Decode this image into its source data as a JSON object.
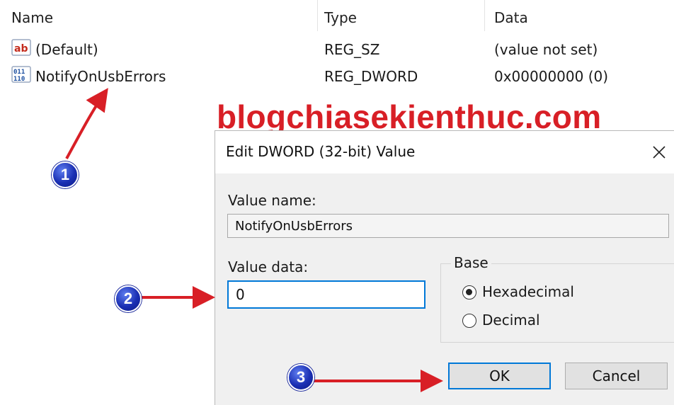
{
  "columns": {
    "name": "Name",
    "type": "Type",
    "data": "Data"
  },
  "rows": [
    {
      "icon": "string-value-icon",
      "icon_text": "ab",
      "name": "(Default)",
      "type": "REG_SZ",
      "data": "(value not set)"
    },
    {
      "icon": "dword-value-icon",
      "icon_text": "011 110",
      "name": "NotifyOnUsbErrors",
      "type": "REG_DWORD",
      "data": "0x00000000 (0)"
    }
  ],
  "watermark": "blogchiasekienthuc.com",
  "dialog": {
    "title": "Edit DWORD (32-bit) Value",
    "close_glyph": "✕",
    "value_name_label": "Value name:",
    "value_name": "NotifyOnUsbErrors",
    "value_data_label": "Value data:",
    "value_data": "0",
    "base_label": "Base",
    "radio_hex": "Hexadecimal",
    "radio_dec": "Decimal",
    "selected_base": "Hexadecimal",
    "ok_label": "OK",
    "cancel_label": "Cancel"
  },
  "badges": [
    "1",
    "2",
    "3"
  ],
  "colors": {
    "arrow": "#d81f26",
    "badge": "#1a2fb3",
    "focus": "#0078d7",
    "watermark": "#d81f26"
  }
}
